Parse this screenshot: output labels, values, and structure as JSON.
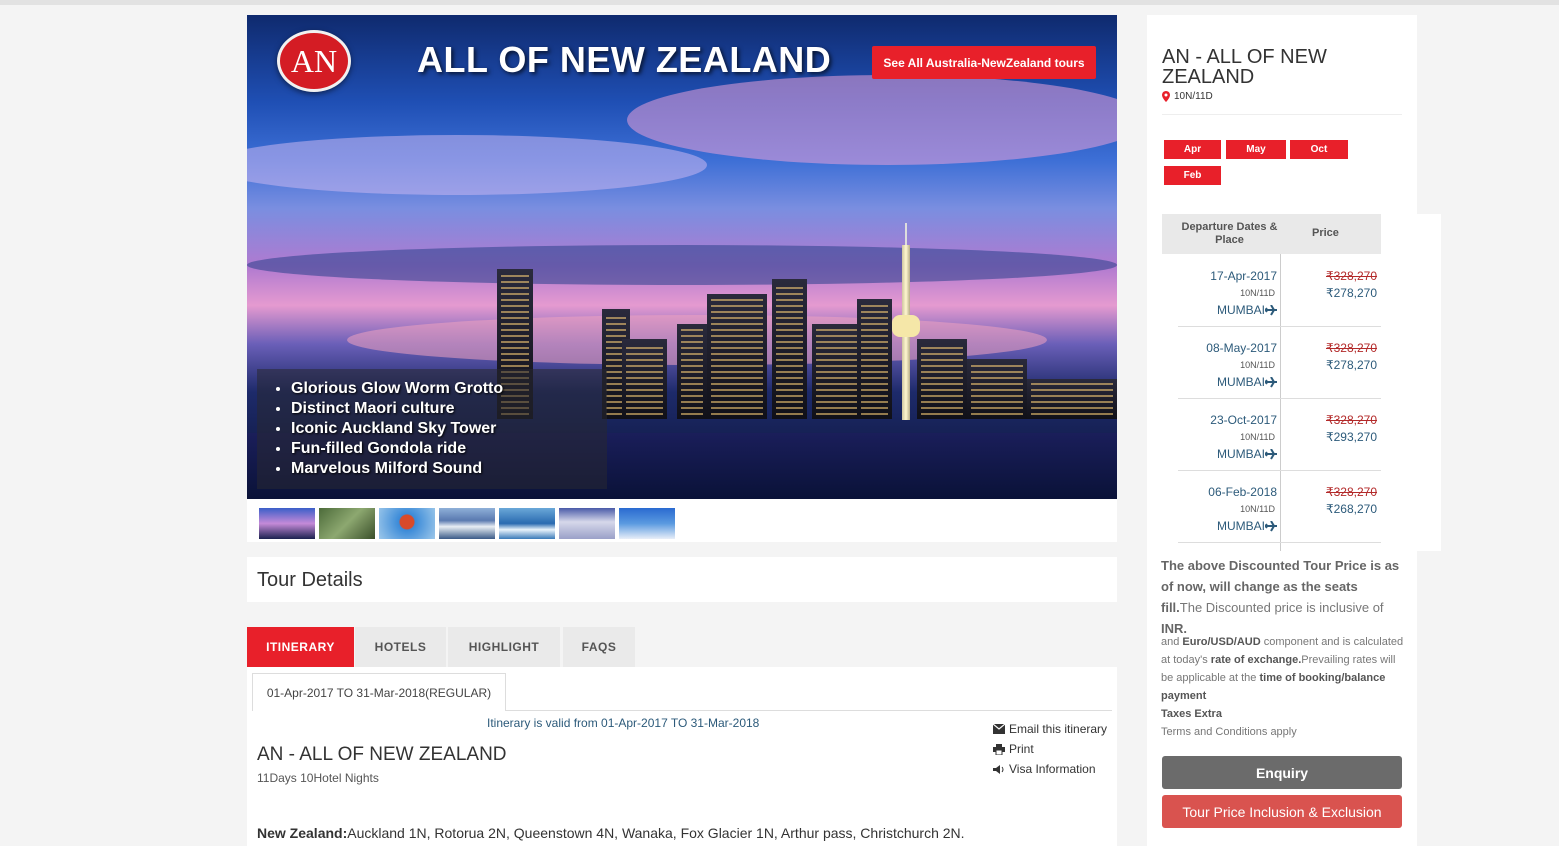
{
  "hero": {
    "logo_text": "AN",
    "title": "ALL OF NEW ZEALAND",
    "see_all_label": "See All Australia-NewZealand tours",
    "highlights": [
      "Glorious Glow Worm Grotto",
      "Distinct Maori culture",
      "Iconic Auckland Sky Tower",
      "Fun-filled Gondola ride",
      "Marvelous Milford Sound"
    ]
  },
  "tour_details": {
    "heading": "Tour Details"
  },
  "tabs": [
    "ITINERARY",
    "HOTELS",
    "HIGHLIGHT",
    "FAQS"
  ],
  "itinerary": {
    "subtab_label": "01-Apr-2017 TO 31-Mar-2018(REGULAR)",
    "valid_text": "Itinerary is valid from 01-Apr-2017 TO 31-Mar-2018",
    "email_label": "Email this itinerary",
    "print_label": "Print",
    "visa_label": "Visa Information",
    "title": "AN - ALL OF NEW ZEALAND",
    "subtitle": "11Days 10Hotel Nights",
    "route_country": "New Zealand:",
    "route_text": "Auckland 1N, Rotorua 2N, Queenstown 4N, Wanaka, Fox Glacier 1N, Arthur pass, Christchurch 2N."
  },
  "sidebar": {
    "title": "AN - ALL OF NEW ZEALAND",
    "duration": "10N/11D",
    "months": [
      "Apr",
      "May",
      "Oct",
      "Feb"
    ],
    "table_head_dates": "Departure Dates & Place",
    "table_head_price": "Price",
    "departures": [
      {
        "date": "17-Apr-2017",
        "duration": "10N/11D",
        "place": "MUMBAI",
        "old_price": "₹328,270",
        "new_price": "₹278,270"
      },
      {
        "date": "08-May-2017",
        "duration": "10N/11D",
        "place": "MUMBAI",
        "old_price": "₹328,270",
        "new_price": "₹278,270"
      },
      {
        "date": "23-Oct-2017",
        "duration": "10N/11D",
        "place": "MUMBAI",
        "old_price": "₹328,270",
        "new_price": "₹293,270"
      },
      {
        "date": "06-Feb-2018",
        "duration": "10N/11D",
        "place": "MUMBAI",
        "old_price": "₹328,270",
        "new_price": "₹268,270"
      }
    ],
    "note1_bold": "The above Discounted Tour Price is as of now, will change as the seats fill.",
    "note1_a": "The Discounted price is inclusive of ",
    "note1_b": "INR.",
    "note2_a": "and ",
    "note2_b": "Euro/USD/AUD",
    "note2_c": " component and is calculated at today's ",
    "note2_d": "rate of exchange.",
    "note2_e": "Prevailing rates will be applicable at the ",
    "note2_f": "time of booking/balance payment",
    "note2_g": "Taxes Extra",
    "note2_h": "Terms and Conditions apply",
    "enquiry_label": "Enquiry",
    "inclusion_label": "Tour Price Inclusion & Exclusion"
  },
  "colors": {
    "accent": "#e8202a",
    "enquiry": "#6b6b6b",
    "inclusion": "#d9534f",
    "link": "#2c5a7a"
  }
}
